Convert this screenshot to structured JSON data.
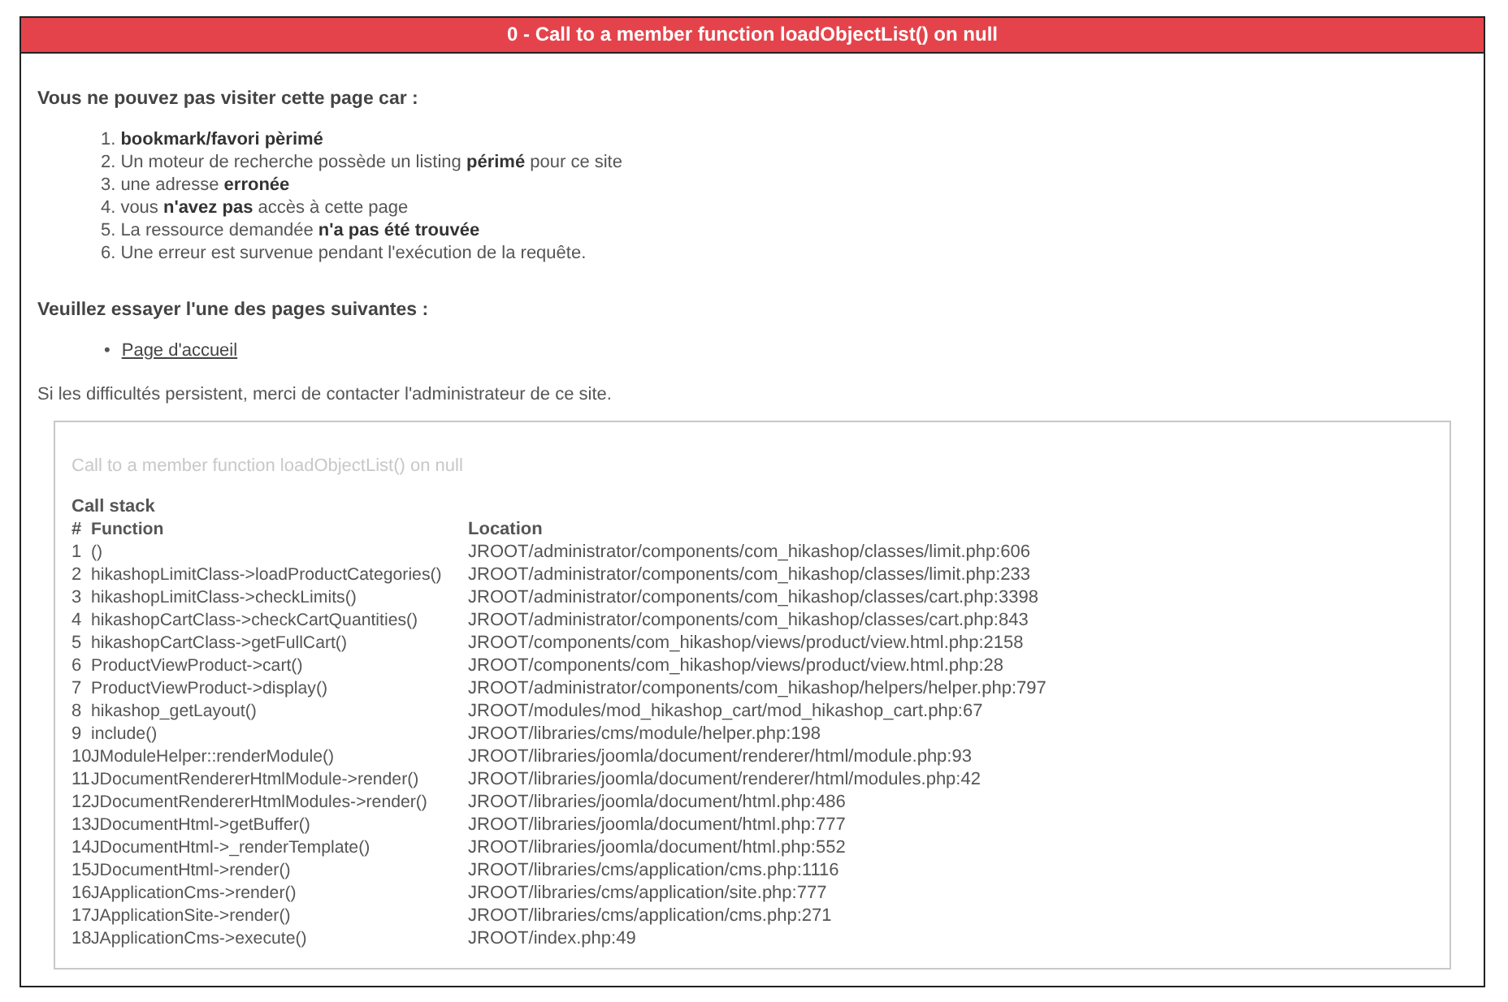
{
  "header": {
    "title": "0 - Call to a member function loadObjectList() on null"
  },
  "reasons": {
    "heading": "Vous ne pouvez pas visiter cette page car :",
    "items": [
      {
        "number": "1.",
        "text": "**bookmark/favori pèrimé**"
      },
      {
        "number": "2.",
        "text": "Un moteur de recherche possède un listing **périmé** pour ce site"
      },
      {
        "number": "3.",
        "text": "une adresse **erronée**"
      },
      {
        "number": "4.",
        "text": "vous **n'avez pas** accès à cette page"
      },
      {
        "number": "5.",
        "text": "La ressource demandée **n'a pas été trouvée**"
      },
      {
        "number": "6.",
        "text": "Une erreur est survenue pendant l'exécution de la requête."
      }
    ]
  },
  "suggestions": {
    "heading": "Veuillez essayer l'une des pages suivantes :",
    "links": [
      {
        "bullet": "•",
        "label": "Page d'accueil"
      }
    ]
  },
  "contact_note": "Si les difficultés persistent, merci de contacter l'administrateur de ce site.",
  "call_stack": {
    "message": "Call to a member function loadObjectList() on null",
    "title": "Call stack",
    "columns": [
      "#",
      "Function",
      "Location"
    ],
    "rows": [
      [
        "1",
        "()",
        "JROOT/administrator/components/com_hikashop/classes/limit.php:606"
      ],
      [
        "2",
        "hikashopLimitClass->loadProductCategories()",
        "JROOT/administrator/components/com_hikashop/classes/limit.php:233"
      ],
      [
        "3",
        "hikashopLimitClass->checkLimits()",
        "JROOT/administrator/components/com_hikashop/classes/cart.php:3398"
      ],
      [
        "4",
        "hikashopCartClass->checkCartQuantities()",
        "JROOT/administrator/components/com_hikashop/classes/cart.php:843"
      ],
      [
        "5",
        "hikashopCartClass->getFullCart()",
        "JROOT/components/com_hikashop/views/product/view.html.php:2158"
      ],
      [
        "6",
        "ProductViewProduct->cart()",
        "JROOT/components/com_hikashop/views/product/view.html.php:28"
      ],
      [
        "7",
        "ProductViewProduct->display()",
        "JROOT/administrator/components/com_hikashop/helpers/helper.php:797"
      ],
      [
        "8",
        "hikashop_getLayout()",
        "JROOT/modules/mod_hikashop_cart/mod_hikashop_cart.php:67"
      ],
      [
        "9",
        "include()",
        "JROOT/libraries/cms/module/helper.php:198"
      ],
      [
        "10",
        "JModuleHelper::renderModule()",
        "JROOT/libraries/joomla/document/renderer/html/module.php:93"
      ],
      [
        "11",
        "JDocumentRendererHtmlModule->render()",
        "JROOT/libraries/joomla/document/renderer/html/modules.php:42"
      ],
      [
        "12",
        "JDocumentRendererHtmlModules->render()",
        "JROOT/libraries/joomla/document/html.php:486"
      ],
      [
        "13",
        "JDocumentHtml->getBuffer()",
        "JROOT/libraries/joomla/document/html.php:777"
      ],
      [
        "14",
        "JDocumentHtml->_renderTemplate()",
        "JROOT/libraries/joomla/document/html.php:552"
      ],
      [
        "15",
        "JDocumentHtml->render()",
        "JROOT/libraries/cms/application/cms.php:1116"
      ],
      [
        "16",
        "JApplicationCms->render()",
        "JROOT/libraries/cms/application/site.php:777"
      ],
      [
        "17",
        "JApplicationSite->render()",
        "JROOT/libraries/cms/application/cms.php:271"
      ],
      [
        "18",
        "JApplicationCms->execute()",
        "JROOT/index.php:49"
      ]
    ]
  }
}
